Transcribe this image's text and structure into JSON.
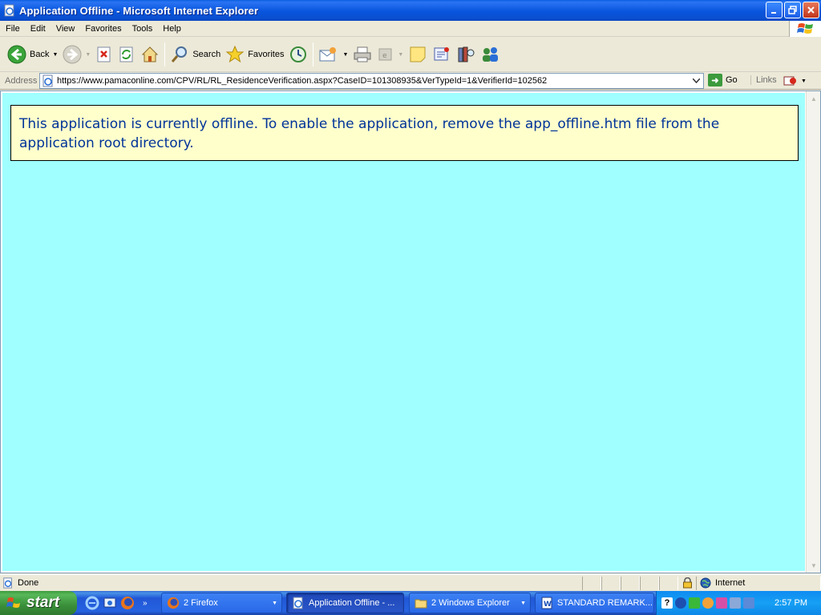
{
  "window": {
    "title": "Application Offline - Microsoft Internet Explorer",
    "buttons": [
      "minimize",
      "restore",
      "close"
    ]
  },
  "menu": [
    "File",
    "Edit",
    "View",
    "Favorites",
    "Tools",
    "Help"
  ],
  "toolbar": {
    "back_label": "Back",
    "search_label": "Search",
    "favorites_label": "Favorites"
  },
  "address": {
    "label": "Address",
    "url": "https://www.pamaconline.com/CPV/RL/RL_ResidenceVerification.aspx?CaseID=101308935&VerTypeId=1&VerifierId=102562",
    "go_label": "Go",
    "links_label": "Links"
  },
  "page": {
    "message": "This application is currently offline. To enable the application, remove the app_offline.htm file from the application root directory.",
    "background_color": "#a0ffff",
    "box_color": "#ffffcc",
    "text_color": "#003399"
  },
  "status": {
    "text": "Done",
    "zone": "Internet"
  },
  "taskbar": {
    "start_label": "start",
    "tasks": [
      {
        "label": "2 Firefox",
        "icon": "firefox-icon"
      },
      {
        "label": "Application Offline - ...",
        "icon": "ie-page-icon"
      },
      {
        "label": "2 Windows Explorer",
        "icon": "folder-icon"
      },
      {
        "label": "STANDARD REMARK...",
        "icon": "word-icon"
      }
    ],
    "clock": "2:57 PM"
  }
}
